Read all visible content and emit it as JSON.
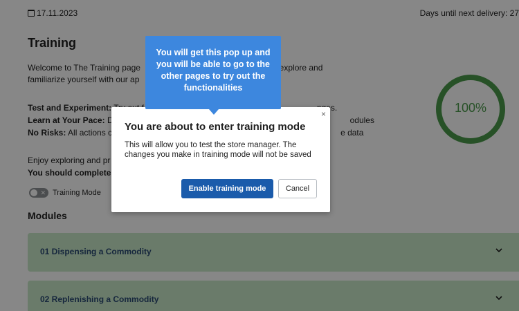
{
  "header": {
    "date": "17.11.2023",
    "delivery_text": "Days until next delivery: 27"
  },
  "training": {
    "title": "Training",
    "welcome_start": "Welcome to The Training page",
    "welcome_end": "you to freely explore and",
    "welcome_line2": "familiarize yourself with our ap",
    "bullets": [
      {
        "label": "Test and Experiment:",
        "text": " Try out f",
        "tail": "nges."
      },
      {
        "label": "Learn at Your Pace:",
        "text": " D",
        "tail": "odules"
      },
      {
        "label": "No Risks:",
        "text": " All actions c",
        "tail": "e data"
      }
    ],
    "enjoy": "Enjoy exploring and pr",
    "complete": "You should complete",
    "toggle_label": "Training Mode",
    "toggle_state": "off"
  },
  "progress": {
    "label": "100%",
    "value": 1.0,
    "color": "#4b9a4b"
  },
  "modules": {
    "title": "Modules",
    "items": [
      {
        "label": "01 Dispensing a Commodity"
      },
      {
        "label": "02 Replenishing a Commodity"
      }
    ]
  },
  "modal": {
    "title": "You are about to enter training mode",
    "body": "This will allow you to test the store manager. The changes you make in training mode will not be saved",
    "primary_button": "Enable training mode",
    "cancel_button": "Cancel",
    "close_symbol": "×"
  },
  "tooltip": {
    "text": "You will get this pop up and you will be able to go to the other pages to try out the functionalities",
    "color": "#3d87de"
  },
  "colors": {
    "module_bg": "#c9e8c9",
    "module_text": "#2b4a73",
    "primary_button": "#1a5bab"
  }
}
